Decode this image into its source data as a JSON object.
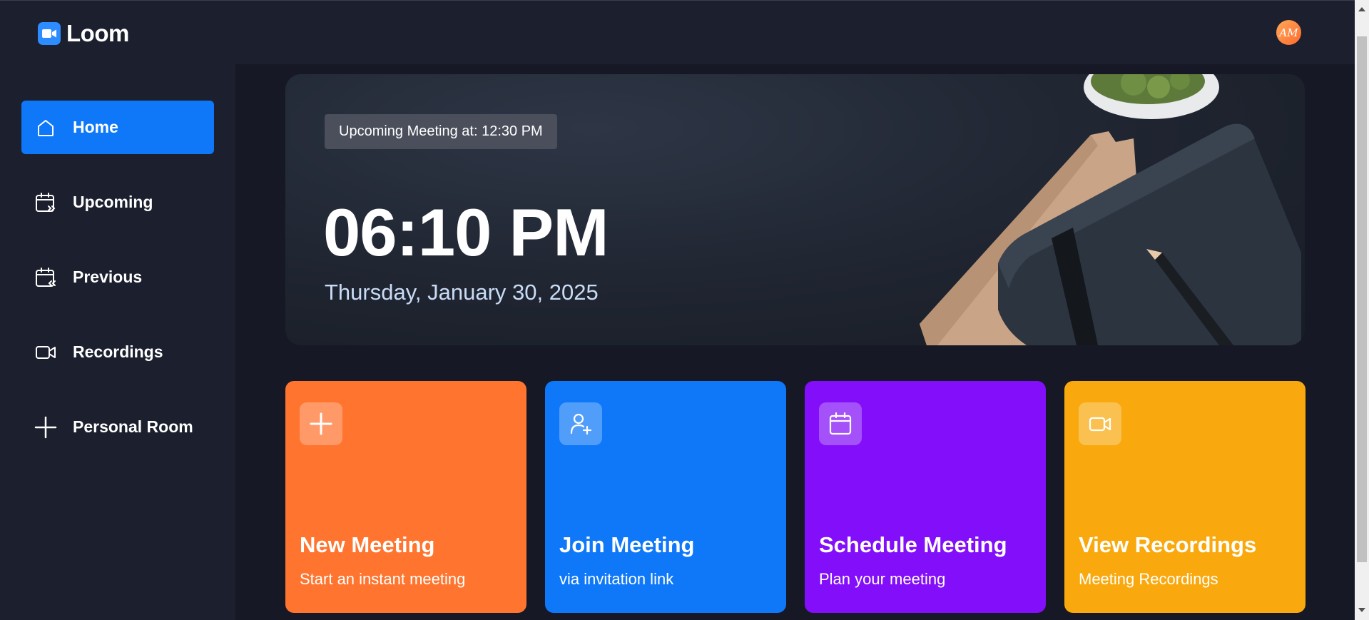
{
  "brand": {
    "name": "Loom",
    "icon": "video-camera-icon",
    "accent": "#2d8cff"
  },
  "user": {
    "avatar_initials": "AM",
    "avatar_color": "#ff7a33"
  },
  "sidebar": {
    "active_color": "#0e78f9",
    "items": [
      {
        "label": "Home",
        "icon": "home-icon",
        "active": true
      },
      {
        "label": "Upcoming",
        "icon": "calendar-forward-icon",
        "active": false
      },
      {
        "label": "Previous",
        "icon": "calendar-back-icon",
        "active": false
      },
      {
        "label": "Recordings",
        "icon": "video-icon",
        "active": false
      },
      {
        "label": "Personal Room",
        "icon": "plus-icon",
        "active": false
      }
    ]
  },
  "hero": {
    "badge": "Upcoming Meeting at: 12:30 PM",
    "time": "06:10 PM",
    "date": "Thursday, January 30, 2025"
  },
  "cards": [
    {
      "title": "New Meeting",
      "subtitle": "Start an instant meeting",
      "icon": "plus-icon",
      "color": "#ff742e"
    },
    {
      "title": "Join Meeting",
      "subtitle": "via invitation link",
      "icon": "user-plus-icon",
      "color": "#0e78f9"
    },
    {
      "title": "Schedule Meeting",
      "subtitle": "Plan your meeting",
      "icon": "calendar-icon",
      "color": "#830ef9"
    },
    {
      "title": "View Recordings",
      "subtitle": "Meeting Recordings",
      "icon": "video-icon",
      "color": "#f9a90e"
    }
  ]
}
